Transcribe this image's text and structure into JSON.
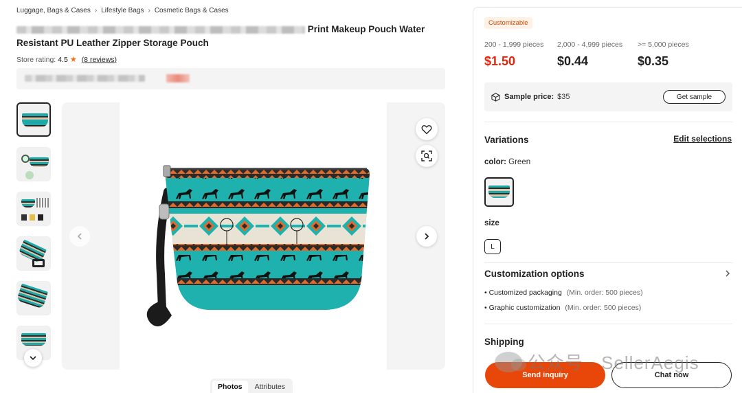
{
  "breadcrumb": [
    "Luggage, Bags & Cases",
    "Lifestyle Bags",
    "Cosmetic Bags & Cases"
  ],
  "product": {
    "title_line1": "Print Makeup Pouch Water",
    "title_line2": "Resistant PU Leather Zipper Storage Pouch",
    "rating_label": "Store rating:",
    "rating_value": "4.5",
    "reviews": "(8 reviews)"
  },
  "gallery": {
    "tabs": [
      "Photos",
      "Attributes"
    ],
    "thumbnail_count": 6
  },
  "pricing": {
    "badge": "Customizable",
    "tiers": [
      {
        "qty": "200 - 1,999 pieces",
        "price": "$1.50"
      },
      {
        "qty": "2,000 - 4,999 pieces",
        "price": "$0.44"
      },
      {
        "qty": ">= 5,000 pieces",
        "price": "$0.35"
      }
    ],
    "sample_label": "Sample price:",
    "sample_value": "$35",
    "sample_button": "Get sample"
  },
  "variations": {
    "heading": "Variations",
    "edit_link": "Edit selections",
    "color_label": "color:",
    "color_value": "Green",
    "size_label": "size",
    "size_value": "L"
  },
  "customization": {
    "heading": "Customization options",
    "items": [
      {
        "name": "Customized packaging",
        "min": "(Min. order: 500 pieces)"
      },
      {
        "name": "Graphic customization",
        "min": "(Min. order: 500 pieces)"
      }
    ]
  },
  "shipping": {
    "heading": "Shipping"
  },
  "actions": {
    "inquiry": "Send inquiry",
    "chat": "Chat now"
  },
  "watermark": "公众号 · SellerAegis",
  "colors": {
    "accent": "#e9460a",
    "price_red": "#e5230b",
    "teal": "#1fa9a6"
  }
}
